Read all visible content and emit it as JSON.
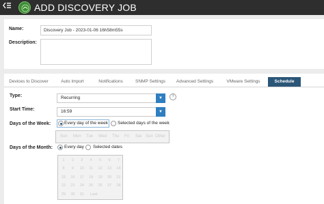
{
  "header": {
    "title": "ADD DISCOVERY JOB",
    "back_icon": "back-menu-icon",
    "logo_icon": "app-logo-icon"
  },
  "form": {
    "name_label": "Name:",
    "name_value": "Discovery Job - 2023-01-06 16h58m55s",
    "description_label": "Description:",
    "description_value": ""
  },
  "tabs": [
    {
      "label": "Devices to Discover"
    },
    {
      "label": "Auto Import"
    },
    {
      "label": "Notifications"
    },
    {
      "label": "SNMP Settings"
    },
    {
      "label": "Advanced Settings"
    },
    {
      "label": "VMware Settings"
    },
    {
      "label": "Schedule"
    }
  ],
  "active_tab": "Schedule",
  "schedule": {
    "type_label": "Type:",
    "type_value": "Recurring",
    "start_time_label": "Start Time:",
    "start_time_value": "16:59",
    "days_of_week_label": "Days of the Week:",
    "every_day_of_week": "Every day of the week",
    "selected_days_of_week": "Selected days of the week",
    "weekdays": [
      "Sun",
      "Mon",
      "Tue",
      "Wed",
      "Thu",
      "Fri",
      "Sat",
      "Sun",
      "Other"
    ],
    "days_of_month_label": "Days of the Month:",
    "every_day": "Every day",
    "selected_dates": "Selected dates",
    "month_days": [
      [
        "1",
        "2",
        "3",
        "4",
        "5",
        "6",
        "7"
      ],
      [
        "8",
        "9",
        "10",
        "11",
        "12",
        "13",
        "14"
      ],
      [
        "15",
        "16",
        "17",
        "18",
        "19",
        "20",
        "21"
      ],
      [
        "22",
        "23",
        "24",
        "25",
        "26",
        "27",
        "28"
      ],
      [
        "29",
        "30",
        "31",
        "Last",
        "",
        "",
        ""
      ]
    ]
  },
  "colors": {
    "header_bg": "#2e2e2e",
    "active_tab_bg": "#2b5678",
    "dropdown_accent": "#2f7ec0"
  }
}
